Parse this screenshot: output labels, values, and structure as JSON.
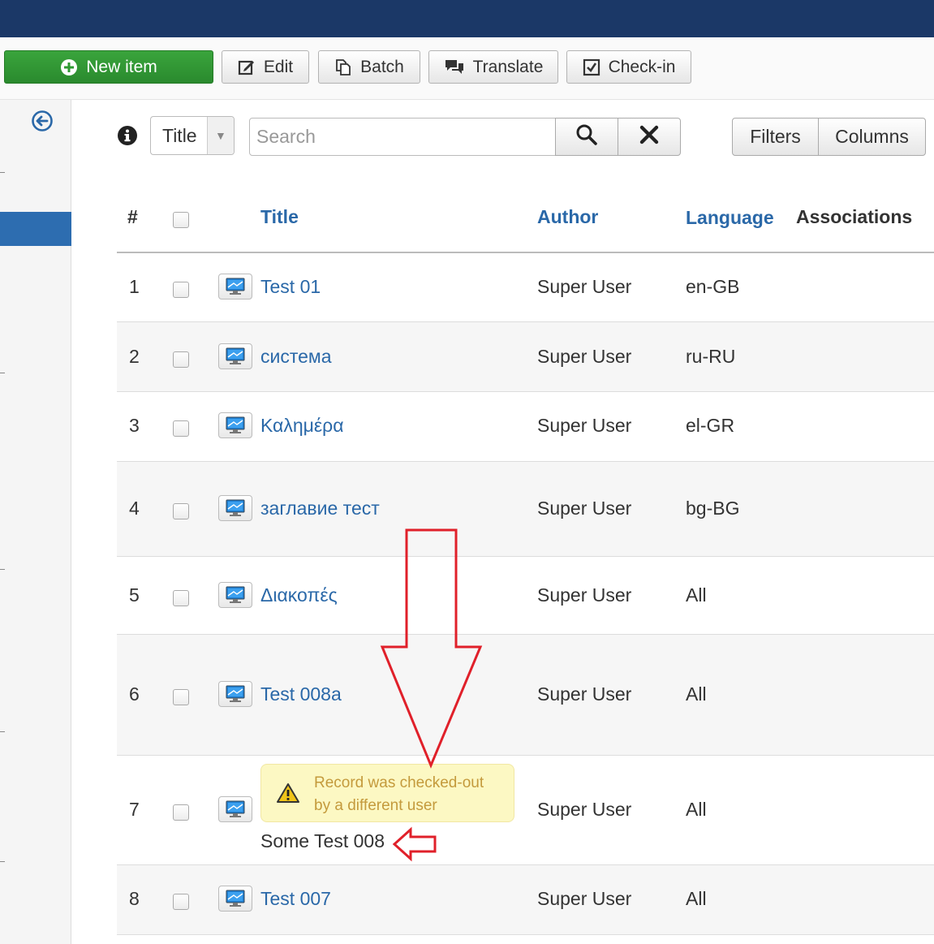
{
  "toolbar": {
    "new_item": "New item",
    "edit": "Edit",
    "batch": "Batch",
    "translate": "Translate",
    "checkin": "Check-in"
  },
  "search": {
    "field_label": "Title",
    "placeholder": "Search",
    "filters": "Filters",
    "columns": "Columns"
  },
  "table": {
    "headers": {
      "num": "#",
      "title": "Title",
      "author": "Author",
      "language": "Language",
      "associations": "Associations"
    },
    "rows": [
      {
        "num": "1",
        "title": "Test 01",
        "author": "Super User",
        "language": "en-GB"
      },
      {
        "num": "2",
        "title": "система",
        "author": "Super User",
        "language": "ru-RU"
      },
      {
        "num": "3",
        "title": "Καλημέρα",
        "author": "Super User",
        "language": "el-GR"
      },
      {
        "num": "4",
        "title": "заглавие тест",
        "author": "Super User",
        "language": "bg-BG"
      },
      {
        "num": "5",
        "title": "Διακοπές",
        "author": "Super User",
        "language": "All"
      },
      {
        "num": "6",
        "title": "Test 008a",
        "author": "Super User",
        "language": "All"
      },
      {
        "num": "7",
        "title": "Some Test 008",
        "author": "Super User",
        "language": "All",
        "alert_line1": "Record was checked-out",
        "alert_line2": "by a different user"
      },
      {
        "num": "8",
        "title": "Test 007",
        "author": "Super User",
        "language": "All"
      }
    ]
  },
  "colors": {
    "header_bar": "#1b3867",
    "link": "#2a68a8",
    "primary_green": "#2f9a32",
    "annotation_red": "#e0202a",
    "warning_bg": "#fcf8c3"
  }
}
